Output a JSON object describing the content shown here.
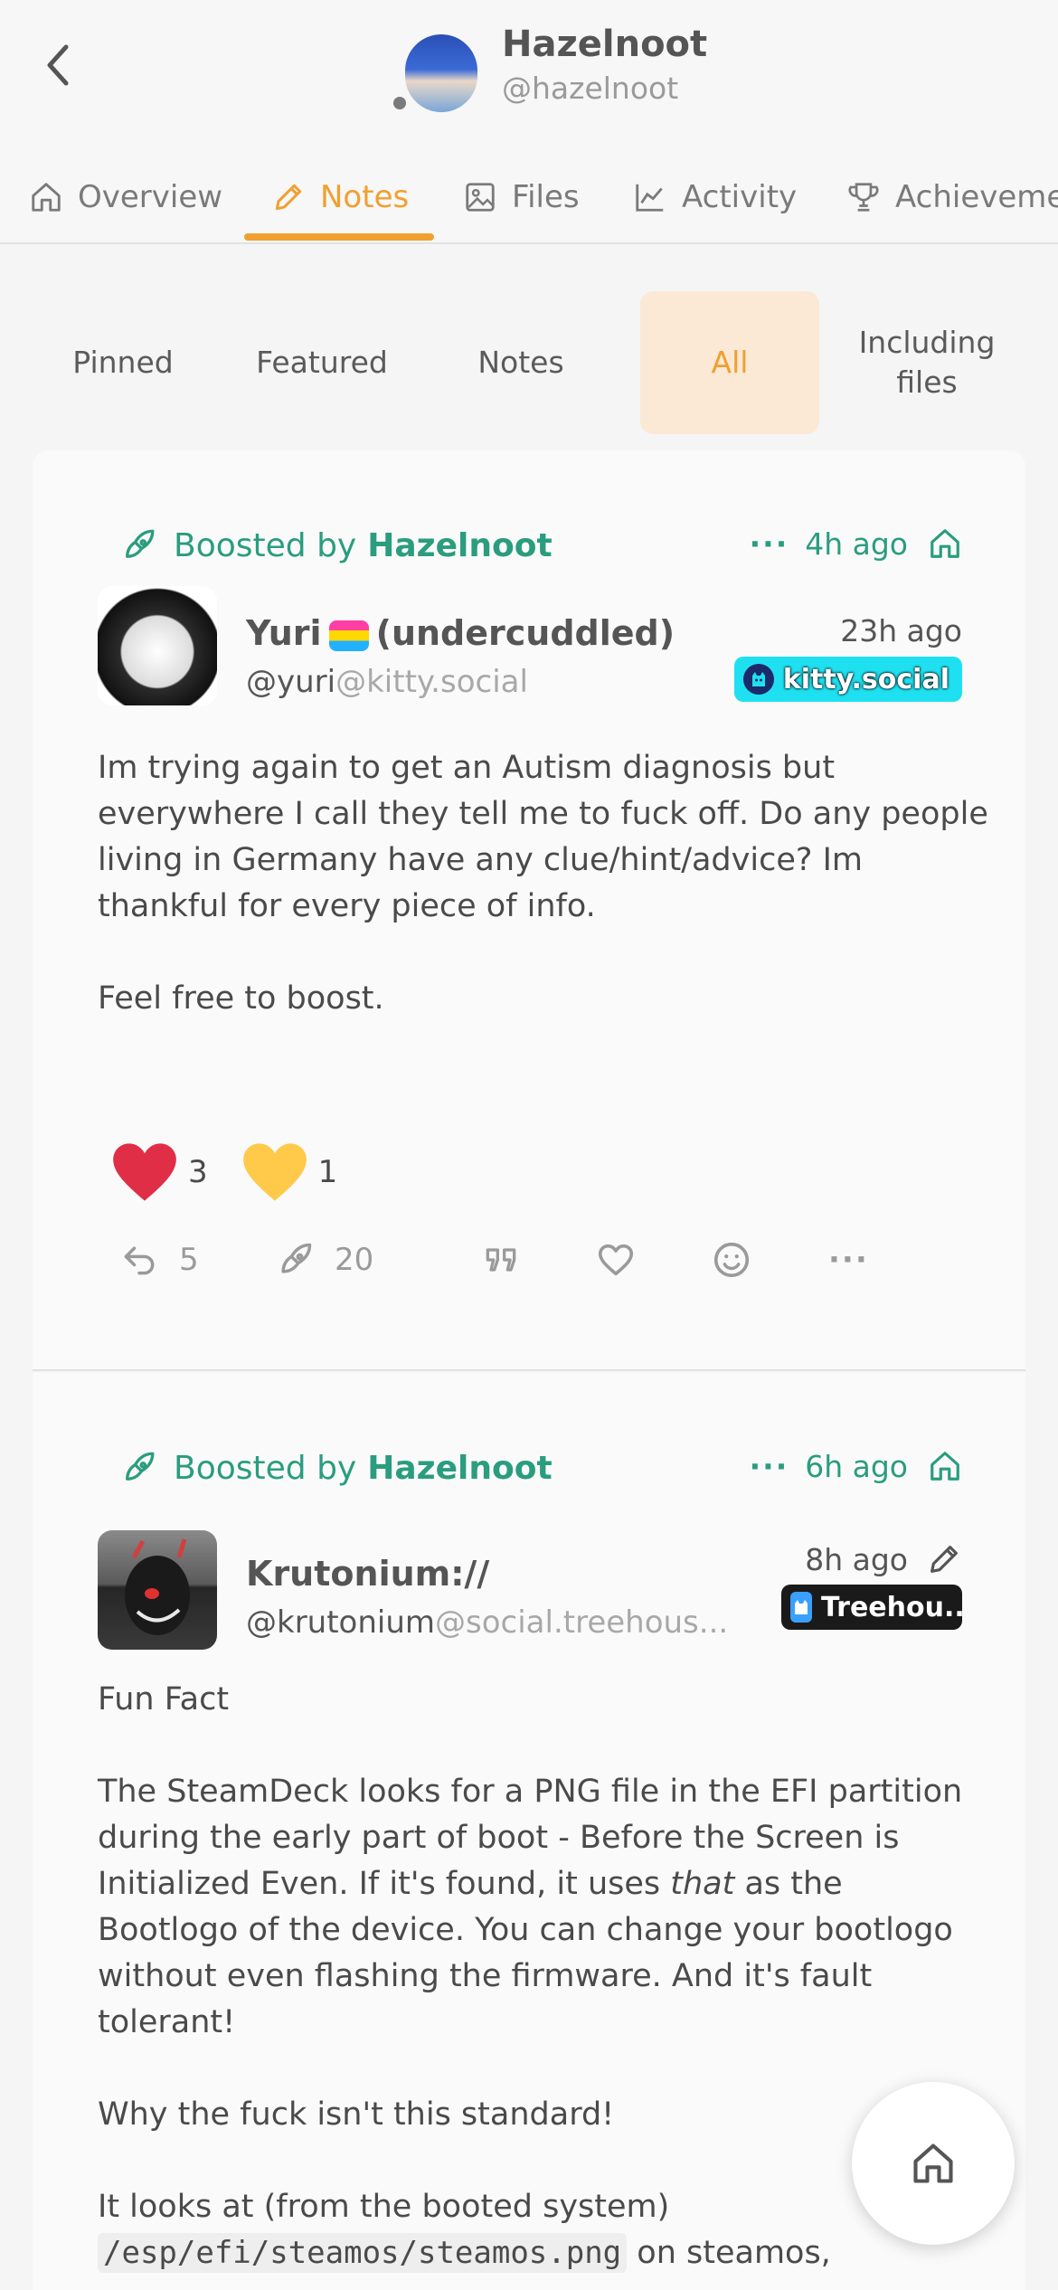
{
  "profile": {
    "name": "Hazelnoot",
    "handle": "@hazelnoot"
  },
  "tabs": [
    {
      "label": "Overview",
      "icon": "home-icon"
    },
    {
      "label": "Notes",
      "icon": "pencil-icon",
      "active": true
    },
    {
      "label": "Files",
      "icon": "image-icon"
    },
    {
      "label": "Activity",
      "icon": "chart-icon"
    },
    {
      "label": "Achieveme",
      "icon": "trophy-icon"
    }
  ],
  "subtabs": [
    {
      "label": "Pinned"
    },
    {
      "label": "Featured"
    },
    {
      "label": "Notes"
    },
    {
      "label": "All",
      "active": true
    },
    {
      "label": "Including files"
    }
  ],
  "notes": [
    {
      "boost_prefix": "Boosted by",
      "boost_user": "Hazelnoot",
      "boost_dots": "···",
      "boost_time": "4h ago",
      "author_name_pre": "Yuri",
      "author_name_post": "(undercuddled)",
      "author_user": "@yuri",
      "author_host": "@kitty.social",
      "time": "23h ago",
      "instance": "kitty.social",
      "text": [
        "Im trying again to get an Autism diagnosis but everywhere I call they tell me to fuck off. Do any people living in Germany have any clue/hint/advice? Im thankful for every piece of info.",
        "Feel free to boost."
      ],
      "reactions": [
        {
          "emoji": "red-heart",
          "count": "3"
        },
        {
          "emoji": "yellow-heart",
          "count": "1"
        }
      ],
      "reply_count": "5",
      "renote_count": "20",
      "more": "···"
    },
    {
      "boost_prefix": "Boosted by",
      "boost_user": "Hazelnoot",
      "boost_dots": "···",
      "boost_time": "6h ago",
      "author_name": "Krutonium://",
      "author_user": "@krutonium",
      "author_host": "@social.treehous...",
      "time": "8h ago",
      "instance": "Treehou...",
      "text_1": "Fun Fact",
      "text_2a": "The SteamDeck looks for a PNG file in the EFI partition during the early part of boot - Before the Screen is Initialized Even. If it's found, it uses ",
      "text_2em": "that",
      "text_2b": " as the Bootlogo of the device. You can change your bootlogo without even flashing the firmware. And it's fault tolerant!",
      "text_3": "Why the fuck isn't this standard!",
      "text_4a": "It looks at (from the booted system) ",
      "text_4code": "/esp/efi/steamos/steamos.png",
      "text_4b": " on steamos,"
    }
  ],
  "colors": {
    "accent": "#f0a030",
    "boost_green": "#2a9d7e",
    "subtab_active_bg": "#fbe9d6"
  }
}
